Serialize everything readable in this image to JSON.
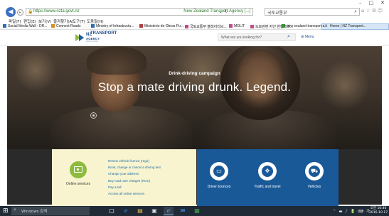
{
  "window": {
    "controls": [
      "–",
      "□",
      "✕"
    ]
  },
  "browser": {
    "address_url": "https://www.nzta.govt.nz",
    "site_identity": "New Zealand Transport Agency [...]",
    "search_text": "국토교통부",
    "menu": [
      "파일(F)",
      "편집(E)",
      "보기(V)",
      "즐겨찾기(A)",
      "도구(T)",
      "도움말(H)"
    ],
    "favorites": [
      {
        "label": "Social Media Wall - DR...",
        "color": "#2e6db4"
      },
      {
        "label": "Connect Roads",
        "color": "#d98c1f"
      },
      {
        "label": "Ministry of Infrastructu...",
        "color": "#2e6db4"
      },
      {
        "label": "Ministerio de Obras Pu...",
        "color": "#b33a3a"
      },
      {
        "label": "국토교통부 블레이티브...",
        "color": "#c24a8e"
      },
      {
        "label": "MOLIT",
        "color": "#c24a8e"
      },
      {
        "label": "도로관련 자인 현황조회...",
        "color": "#c24a8e"
      },
      {
        "label": "new zealand transport a...",
        "color": "#3b8a3b"
      }
    ],
    "active_tab": "Home | NZ Transport..."
  },
  "site": {
    "logo_line1": "NZ",
    "logo_line2": "TRANSPORT",
    "logo_line3": "AGENCY",
    "logo_line4": "WAKA KOTAHI",
    "search_placeholder": "What are you looking for?",
    "menu_label": "Menu"
  },
  "hero": {
    "campaign_label": "Drink-driving campaign",
    "headline": "Stop a mate driving drunk. Legend."
  },
  "online_services": {
    "label": "Online services",
    "links": [
      "Renew vehicle licence (rego)",
      "Book, change or cancel a driving test",
      "Change your address",
      "Buy road user charges (RUC)",
      "Pay a toll",
      "Access all online services"
    ]
  },
  "service_tiles": [
    {
      "label": "Driver licences",
      "icon": "id-card-icon"
    },
    {
      "label": "Traffic and travel",
      "icon": "road-sign-icon"
    },
    {
      "label": "Vehicles",
      "icon": "car-icon"
    }
  ],
  "taskbar": {
    "search_placeholder": "Windows 검색",
    "clock_time": "오전 10:40",
    "clock_date": "2016-10-17"
  },
  "colors": {
    "nzta_blue": "#1a5998",
    "nzta_green": "#8dbb3e",
    "online_panel": "#f7f4cf"
  }
}
